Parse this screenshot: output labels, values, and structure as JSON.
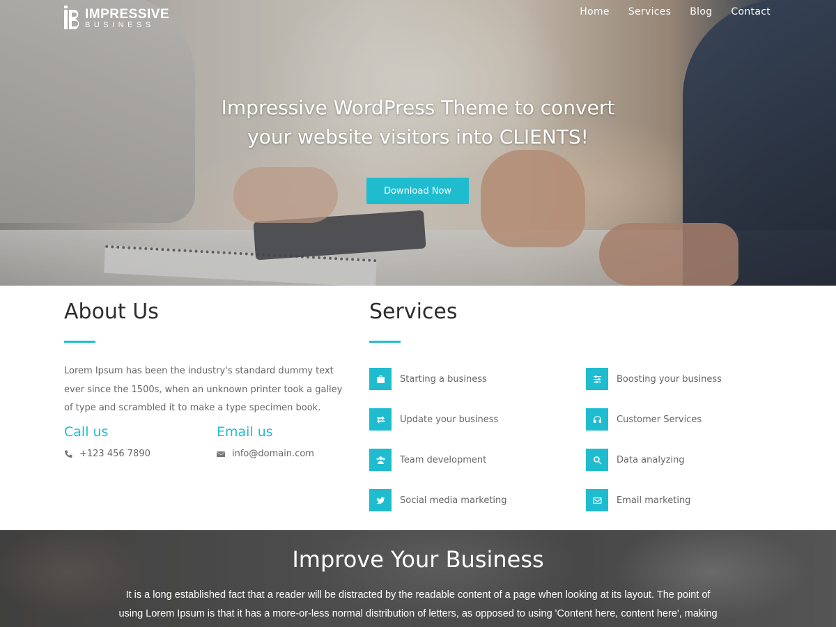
{
  "header": {
    "logo_line1": "IMPRESSIVE",
    "logo_line2": "BUSINESS",
    "nav": [
      "Home",
      "Services",
      "Blog",
      "Contact"
    ]
  },
  "hero": {
    "title_line1": "Impressive WordPress Theme to convert",
    "title_line2": "your website visitors into CLIENTS!",
    "button_label": "Download Now"
  },
  "about": {
    "title": "About Us",
    "text": "Lorem Ipsum has been the industry's standard dummy text ever since the 1500s, when an unknown printer took a galley of type and scrambled it to make a type specimen book.",
    "call_title": "Call us",
    "phone": "+123 456 7890",
    "email_title": "Email us",
    "email": "info@domain.com"
  },
  "services": {
    "title": "Services",
    "items": [
      {
        "label": "Starting a business",
        "icon": "briefcase-icon"
      },
      {
        "label": "Boosting your business",
        "icon": "sliders-icon"
      },
      {
        "label": "Update your business",
        "icon": "exchange-icon"
      },
      {
        "label": "Customer Services",
        "icon": "headphones-icon"
      },
      {
        "label": "Team development",
        "icon": "users-icon"
      },
      {
        "label": "Data analyzing",
        "icon": "search-icon"
      },
      {
        "label": "Social media marketing",
        "icon": "twitter-icon"
      },
      {
        "label": "Email marketing",
        "icon": "envelope-icon"
      }
    ]
  },
  "improve": {
    "title": "Improve Your Business",
    "text_line1": "It is a long established fact that a reader will be distracted by the readable content of a page when looking at its layout. The point of",
    "text_line2": "using Lorem Ipsum is that it has a more-or-less normal distribution of letters, as opposed to using 'Content here, content here', making"
  },
  "colors": {
    "accent": "#1fbcd0",
    "heading": "#2d2d2d",
    "body_text": "#666666"
  }
}
